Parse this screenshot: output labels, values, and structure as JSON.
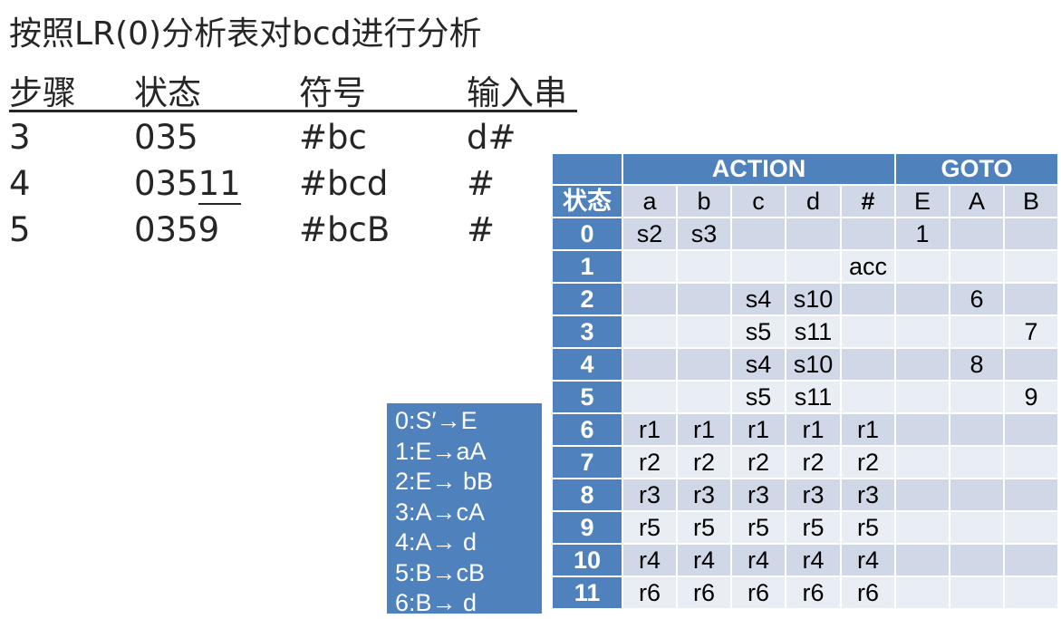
{
  "title": "按照LR(0)分析表对bcd进行分析",
  "steps": {
    "headers": [
      "步骤",
      "状态",
      "符号",
      "输入串"
    ],
    "rows": [
      {
        "step": "3",
        "state_main": "035",
        "state_ul": "",
        "symbols": "#bc",
        "input": "d#"
      },
      {
        "step": "4",
        "state_main": "035",
        "state_ul": "11",
        "symbols": "#bcd",
        "input": "#"
      },
      {
        "step": "5",
        "state_main": "0359",
        "state_ul": "",
        "symbols": "#bcB",
        "input": "#"
      }
    ]
  },
  "grammar": [
    "0:S′→E",
    "1:E→aA",
    "2:E→ bB",
    "3:A→cA",
    "4:A→ d",
    "5:B→cB",
    "6:B→ d"
  ],
  "table": {
    "action_label": "ACTION",
    "goto_label": "GOTO",
    "state_label": "状态",
    "columns": [
      "a",
      "b",
      "c",
      "d",
      "#",
      "E",
      "A",
      "B"
    ],
    "rows": [
      {
        "state": "0",
        "cells": [
          "s2",
          "s3",
          "",
          "",
          "",
          "1",
          "",
          ""
        ]
      },
      {
        "state": "1",
        "cells": [
          "",
          "",
          "",
          "",
          "acc",
          "",
          "",
          ""
        ]
      },
      {
        "state": "2",
        "cells": [
          "",
          "",
          "s4",
          "s10",
          "",
          "",
          "6",
          ""
        ]
      },
      {
        "state": "3",
        "cells": [
          "",
          "",
          "s5",
          "s11",
          "",
          "",
          "",
          "7"
        ]
      },
      {
        "state": "4",
        "cells": [
          "",
          "",
          "s4",
          "s10",
          "",
          "",
          "8",
          ""
        ]
      },
      {
        "state": "5",
        "cells": [
          "",
          "",
          "s5",
          "s11",
          "",
          "",
          "",
          "9"
        ]
      },
      {
        "state": "6",
        "cells": [
          "r1",
          "r1",
          "r1",
          "r1",
          "r1",
          "",
          "",
          ""
        ]
      },
      {
        "state": "7",
        "cells": [
          "r2",
          "r2",
          "r2",
          "r2",
          "r2",
          "",
          "",
          ""
        ]
      },
      {
        "state": "8",
        "cells": [
          "r3",
          "r3",
          "r3",
          "r3",
          "r3",
          "",
          "",
          ""
        ]
      },
      {
        "state": "9",
        "cells": [
          "r5",
          "r5",
          "r5",
          "r5",
          "r5",
          "",
          "",
          ""
        ]
      },
      {
        "state": "10",
        "cells": [
          "r4",
          "r4",
          "r4",
          "r4",
          "r4",
          "",
          "",
          ""
        ]
      },
      {
        "state": "11",
        "cells": [
          "r6",
          "r6",
          "r6",
          "r6",
          "r6",
          "",
          "",
          ""
        ]
      }
    ]
  },
  "colors": {
    "header_blue": "#4f81bd",
    "cell_light": "#e9edf4",
    "cell_alt": "#d0d8e8"
  }
}
